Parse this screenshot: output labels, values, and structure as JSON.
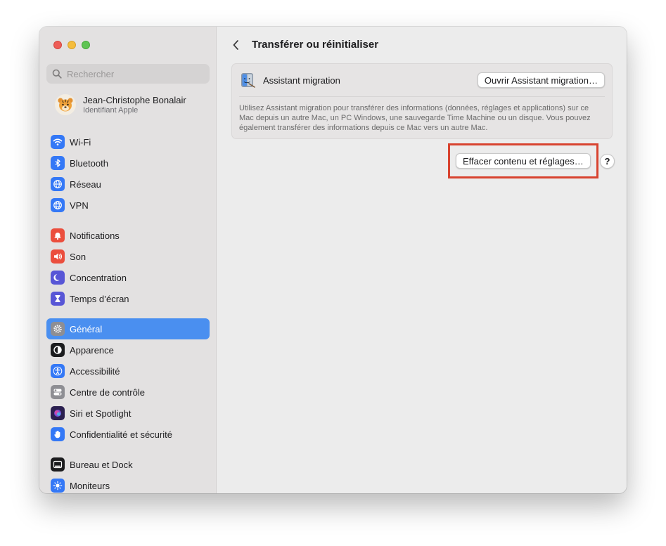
{
  "window": {
    "traffic_lights": {
      "close": "#ee5d57",
      "minimize": "#f5bd3c",
      "maximize": "#5fc453"
    }
  },
  "sidebar": {
    "search": {
      "placeholder": "Rechercher",
      "icon": "search-icon"
    },
    "profile": {
      "name": "Jean-Christophe Bonalair",
      "subtitle": "Identifiant Apple",
      "icon": "tiger-avatar"
    },
    "groups": [
      {
        "items": [
          {
            "label": "Wi-Fi",
            "icon": "wifi-icon",
            "color": "#3478f6"
          },
          {
            "label": "Bluetooth",
            "icon": "bluetooth-icon",
            "color": "#3478f6"
          },
          {
            "label": "Réseau",
            "icon": "globe-icon",
            "color": "#3478f6"
          },
          {
            "label": "VPN",
            "icon": "vpn-globe-icon",
            "color": "#3478f6"
          }
        ]
      },
      {
        "items": [
          {
            "label": "Notifications",
            "icon": "bell-icon",
            "color": "#eb4e3d"
          },
          {
            "label": "Son",
            "icon": "speaker-icon",
            "color": "#eb4e3d"
          },
          {
            "label": "Concentration",
            "icon": "moon-icon",
            "color": "#5856d6"
          },
          {
            "label": "Temps d’écran",
            "icon": "hourglass-icon",
            "color": "#5856d6"
          }
        ]
      },
      {
        "items": [
          {
            "label": "Général",
            "icon": "gear-icon",
            "color": "#8e8e93",
            "active": true
          },
          {
            "label": "Apparence",
            "icon": "appearance-icon",
            "color": "#1c1c1e"
          },
          {
            "label": "Accessibilité",
            "icon": "accessibility-icon",
            "color": "#3478f6"
          },
          {
            "label": "Centre de contrôle",
            "icon": "toggles-icon",
            "color": "#8e8e93"
          },
          {
            "label": "Siri et Spotlight",
            "icon": "siri-icon",
            "color": "#5e3cc4"
          },
          {
            "label": "Confidentialité et sécurité",
            "icon": "hand-icon",
            "color": "#3478f6"
          }
        ]
      },
      {
        "items": [
          {
            "label": "Bureau et Dock",
            "icon": "dock-icon",
            "color": "#1c1c1e"
          },
          {
            "label": "Moniteurs",
            "icon": "sun-icon",
            "color": "#3478f6"
          }
        ]
      }
    ]
  },
  "main": {
    "back_icon": "chevron-left-icon",
    "title": "Transférer ou réinitialiser",
    "migration": {
      "label": "Assistant migration",
      "button": "Ouvrir Assistant migration…",
      "icon": "migration-assistant-icon",
      "description": "Utilisez Assistant migration pour transférer des informations (données, réglages et applications) sur ce Mac depuis un autre Mac, un PC Windows, une sauvegarde Time Machine ou un disque. Vous pouvez également transférer des informations depuis ce Mac vers un autre Mac."
    },
    "erase_button": "Effacer contenu et réglages…",
    "help_button": "?",
    "highlight_color": "#d8432f"
  }
}
